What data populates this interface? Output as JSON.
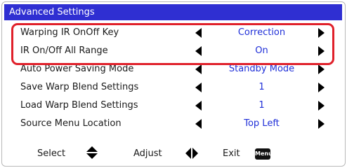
{
  "title": "Advanced Settings",
  "rows": [
    {
      "label": "Warping IR OnOff Key",
      "value": "Correction"
    },
    {
      "label": "IR On/Off All Range",
      "value": "On"
    },
    {
      "label": "Auto Power Saving Mode",
      "value": "Standby Mode"
    },
    {
      "label": "Save Warp Blend Settings",
      "value": "1"
    },
    {
      "label": "Load Warp Blend Settings",
      "value": "1"
    },
    {
      "label": "Source Menu Location",
      "value": "Top Left"
    }
  ],
  "footer": {
    "select_label": "Select",
    "adjust_label": "Adjust",
    "exit_label": "Exit",
    "menu_key": "Menu"
  },
  "colors": {
    "title_bg": "#2f2fd2",
    "value_text": "#1f2fd8",
    "highlight": "#e0202a"
  },
  "icons": {
    "row_left": "left-triangle-icon",
    "row_right": "right-triangle-icon",
    "select": "up-down-icon",
    "adjust": "left-right-icon",
    "exit": "menu-key-icon"
  }
}
